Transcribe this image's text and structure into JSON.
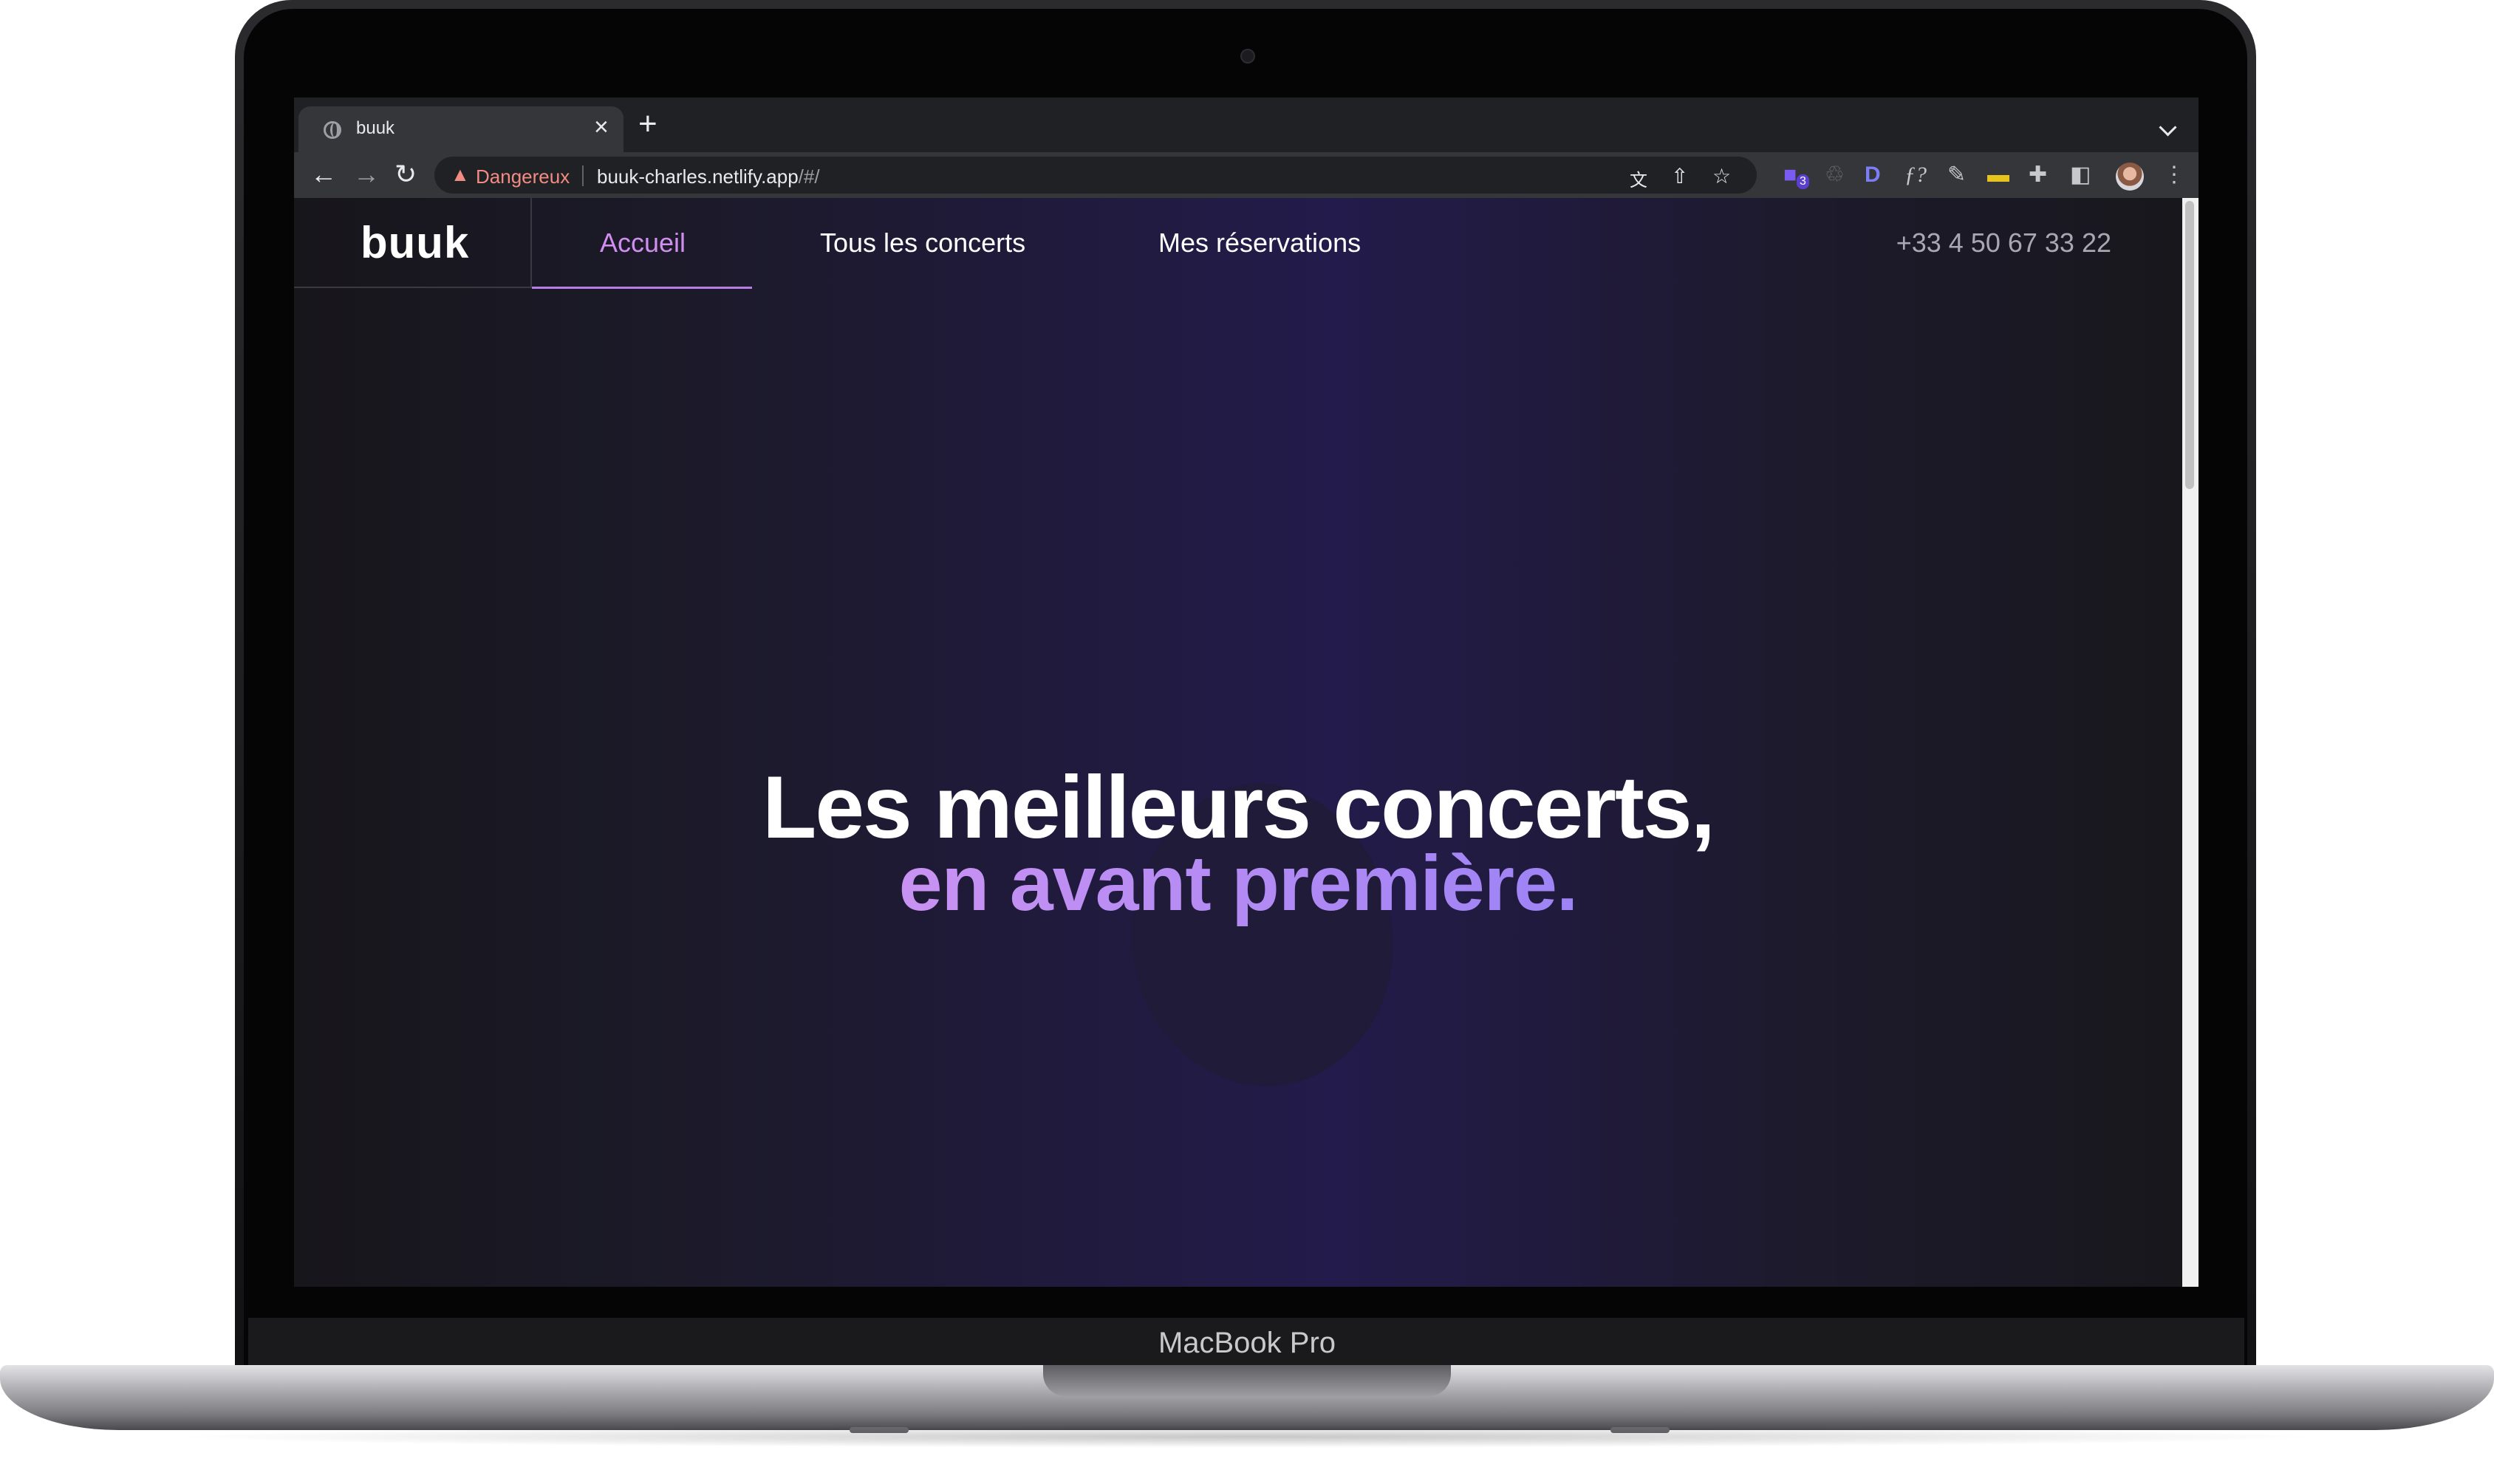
{
  "browser": {
    "tab_title": "buuk",
    "close_glyph": "×",
    "new_tab_glyph": "+",
    "back_glyph": "←",
    "forward_glyph": "→",
    "reload_glyph": "↻",
    "security_label": "Dangereux",
    "url_host": "buuk-charles.netlify.app",
    "url_path": "/#/",
    "icons": [
      "translate-icon",
      "share-icon",
      "bookmark-star-icon",
      "extension-badge-icon",
      "recycle-icon",
      "d-extension-icon",
      "function-extension-icon",
      "pen-extension-icon",
      "folder-extension-icon",
      "puzzle-extensions-icon",
      "side-panel-icon",
      "profile-avatar",
      "menu-dots-icon"
    ],
    "extension_badge_count": "3"
  },
  "site": {
    "logo": "buuk",
    "nav": [
      {
        "label": "Accueil",
        "active": true
      },
      {
        "label": "Tous les concerts",
        "active": false
      },
      {
        "label": "Mes réservations",
        "active": false
      }
    ],
    "phone": "+33 4 50 67 33 22"
  },
  "hero": {
    "line1": "Les meilleurs concerts,",
    "line2": "en avant première."
  },
  "device": {
    "label": "MacBook Pro"
  },
  "colors": {
    "accent": "#d08ff0",
    "gradient_start": "#c992f2",
    "gradient_end": "#9d83f5",
    "danger": "#f28b82"
  }
}
